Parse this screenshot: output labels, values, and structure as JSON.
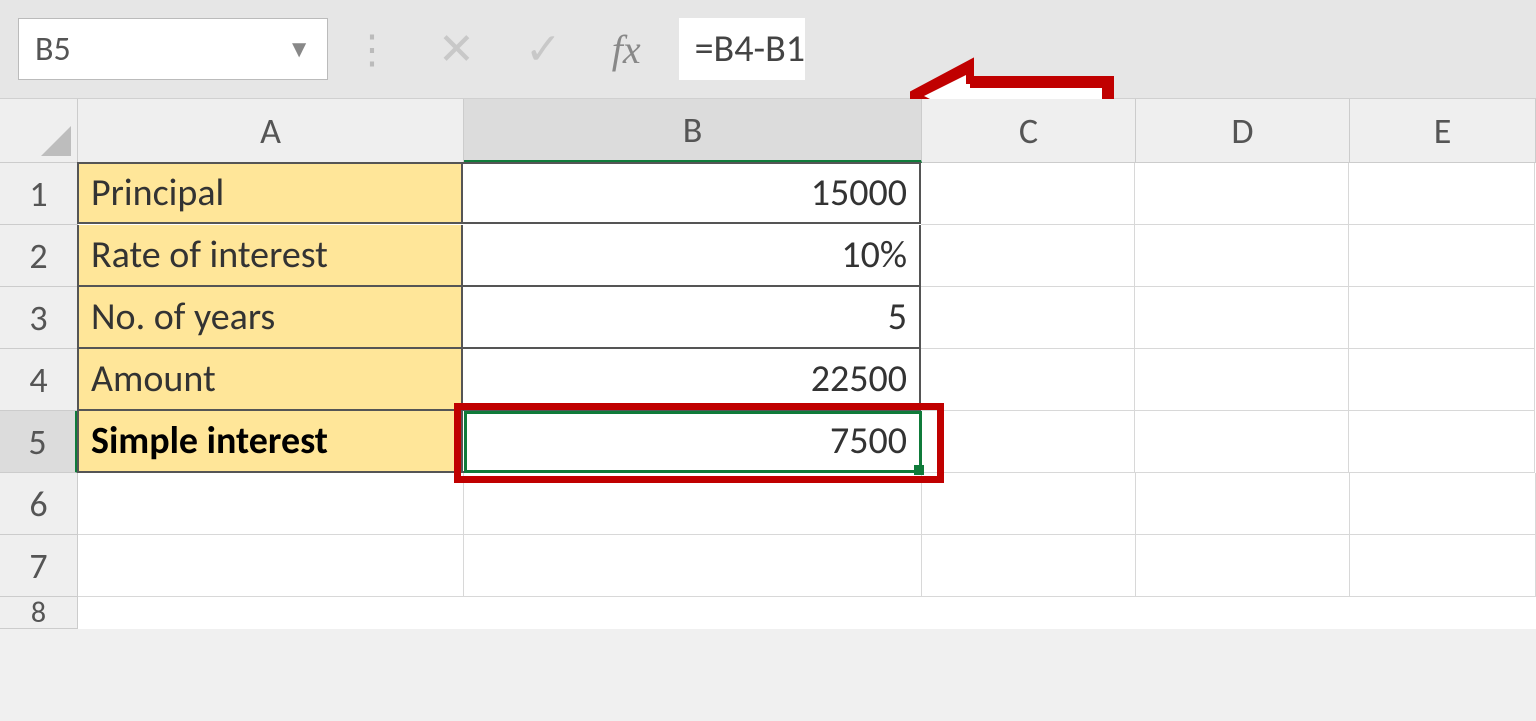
{
  "name_box": {
    "value": "B5"
  },
  "formula_bar": {
    "formula": "=B4-B1",
    "fx_label": "fx"
  },
  "columns": [
    "A",
    "B",
    "C",
    "D",
    "E"
  ],
  "rows": [
    "1",
    "2",
    "3",
    "4",
    "5",
    "6",
    "7",
    "8"
  ],
  "sheet": {
    "a1": "Principal",
    "b1": "15000",
    "a2": "Rate of interest",
    "b2": "10%",
    "a3": "No. of years",
    "b3": "5",
    "a4": "Amount",
    "b4": "22500",
    "a5": "Simple interest",
    "b5": "7500"
  },
  "active_cell": "B5",
  "callout": {
    "points_to": "formula-bar",
    "color": "#c00000"
  }
}
